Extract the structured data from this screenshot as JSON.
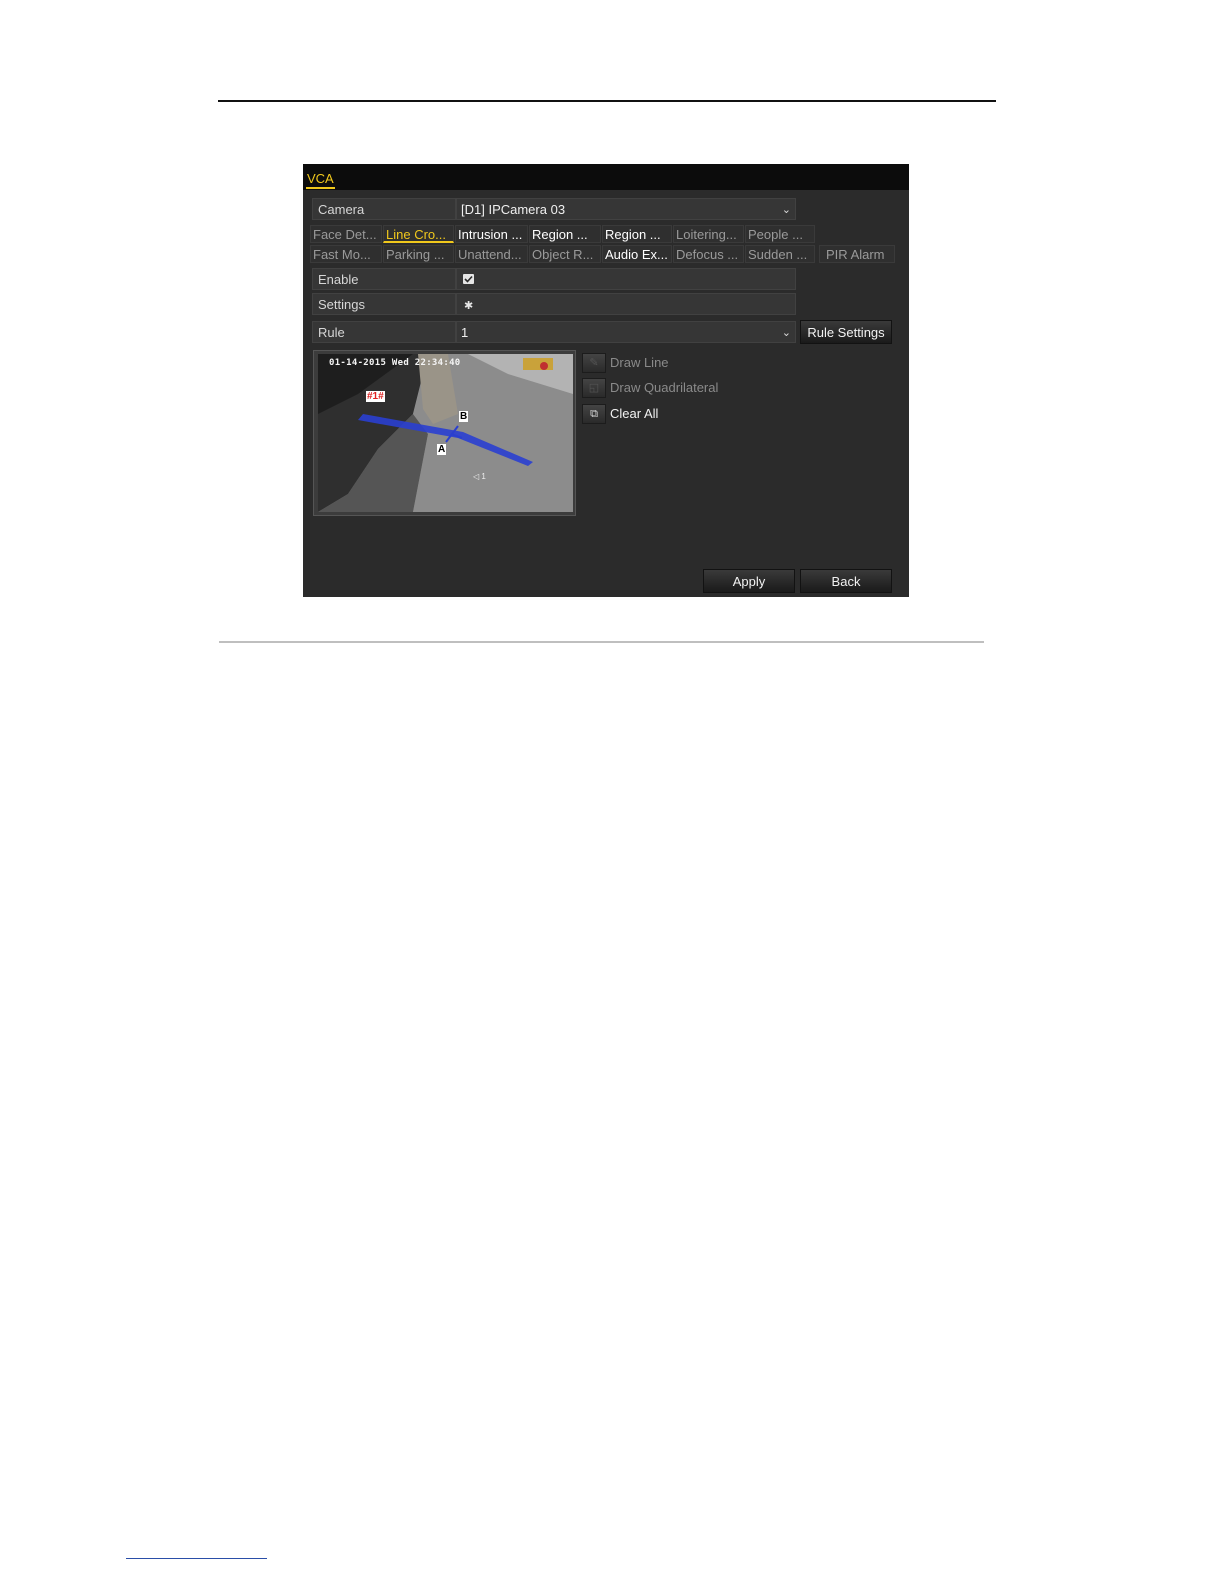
{
  "window": {
    "title": "VCA"
  },
  "camera": {
    "label": "Camera",
    "value": "[D1] IPCamera 03"
  },
  "tabs_row1": [
    {
      "label": "Face Det...",
      "state": "dim"
    },
    {
      "label": "Line Cro...",
      "state": "active"
    },
    {
      "label": "Intrusion ...",
      "state": "bright"
    },
    {
      "label": "Region ...",
      "state": "bright"
    },
    {
      "label": "Region ...",
      "state": "bright"
    },
    {
      "label": "Loitering...",
      "state": "dim"
    },
    {
      "label": "People ...",
      "state": "dim"
    }
  ],
  "tabs_row2": [
    {
      "label": "Fast Mo...",
      "state": "dim"
    },
    {
      "label": "Parking ...",
      "state": "dim"
    },
    {
      "label": "Unattend...",
      "state": "dim"
    },
    {
      "label": "Object R...",
      "state": "dim"
    },
    {
      "label": "Audio Ex...",
      "state": "bright"
    },
    {
      "label": "Defocus ...",
      "state": "dim"
    },
    {
      "label": "Sudden ...",
      "state": "dim"
    },
    {
      "label": "PIR Alarm",
      "state": "dim"
    }
  ],
  "enable": {
    "label": "Enable",
    "checked": true
  },
  "settings": {
    "label": "Settings",
    "icon": "gear-icon"
  },
  "rule": {
    "label": "Rule",
    "value": "1",
    "settings_button": "Rule Settings"
  },
  "video": {
    "osd_timestamp": "01-14-2015 Wed 22:34:40",
    "rule_tag": "#1#",
    "point_a": "A",
    "point_b": "B",
    "channel": "◁ 1"
  },
  "tools": {
    "draw_line": "Draw Line",
    "draw_quadrilateral": "Draw Quadrilateral",
    "clear_all": "Clear All"
  },
  "buttons": {
    "apply": "Apply",
    "back": "Back"
  },
  "colors": {
    "accent": "#f0c81c",
    "panel": "#2b2b2b",
    "titlebar": "#0c0c0c",
    "line": "#2a3fd0"
  }
}
